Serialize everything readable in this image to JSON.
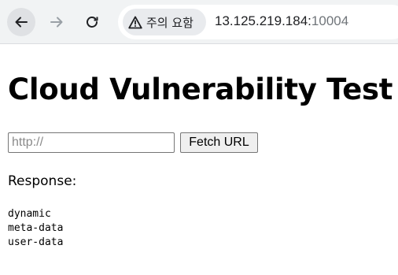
{
  "browser": {
    "back_icon": "arrow-left-icon",
    "forward_icon": "arrow-right-icon",
    "reload_icon": "reload-icon",
    "security_icon": "warning-triangle-icon",
    "security_label": "주의 요함",
    "url_host": "13.125.219.184:",
    "url_port": "10004"
  },
  "page": {
    "title": "Cloud Vulnerability Test",
    "url_input_placeholder": "http://",
    "url_input_value": "",
    "fetch_button_label": "Fetch URL",
    "response_label": "Response:",
    "response_lines": [
      "dynamic",
      "meta-data",
      "user-data"
    ]
  }
}
